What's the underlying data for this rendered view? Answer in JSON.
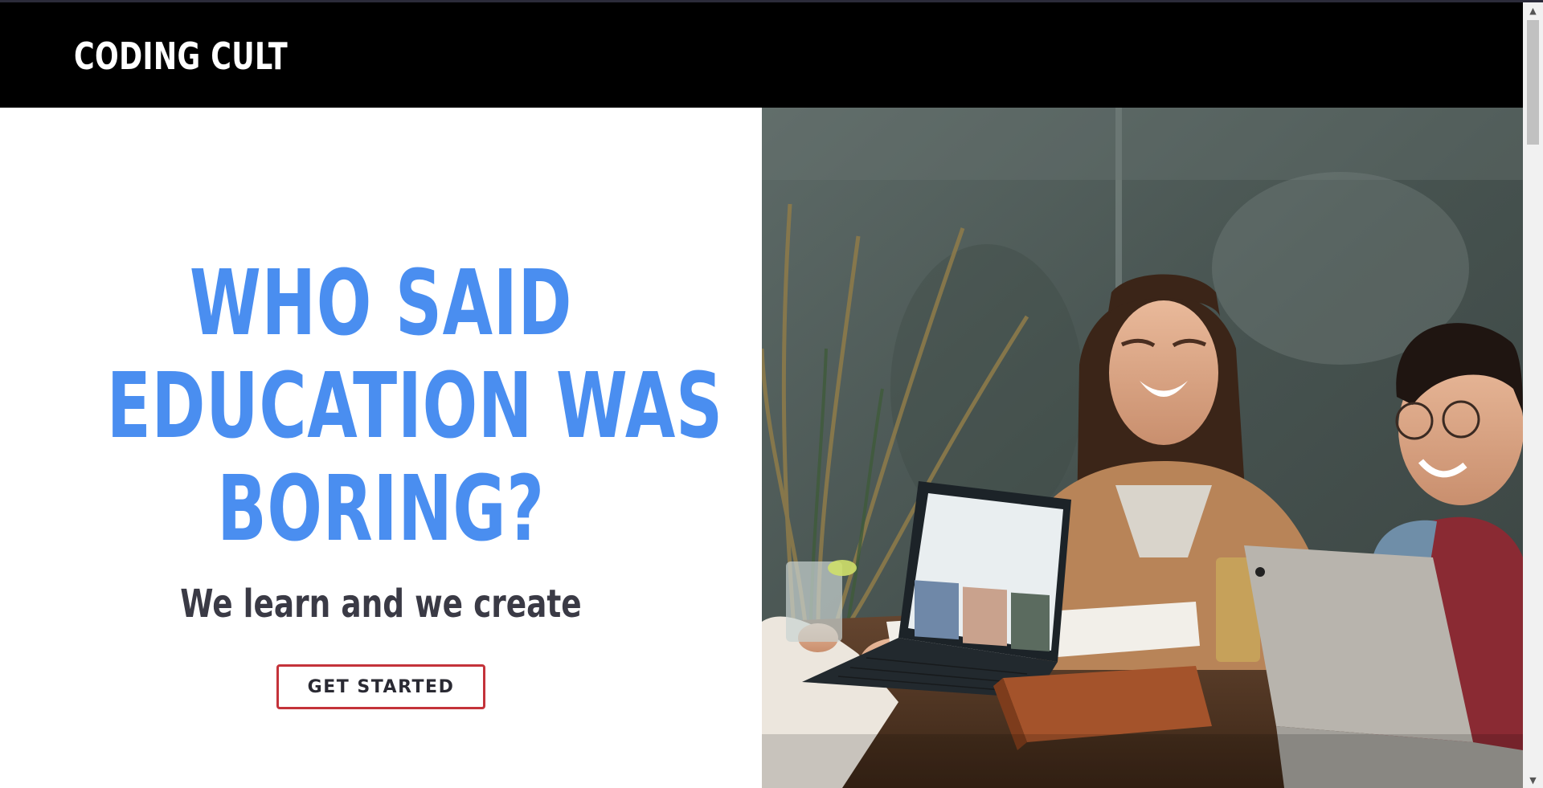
{
  "header": {
    "brand": "CODING CULT"
  },
  "hero": {
    "headline_lines": [
      "WHO SAID",
      "EDUCATION WAS",
      "BORING?"
    ],
    "subheading": "We learn and we create",
    "cta_label": "GET STARTED"
  },
  "photo": {
    "description_icon": "hero-photo-students-laughing-with-laptops"
  },
  "colors": {
    "navbar_bg": "#000000",
    "brand_text": "#ffffff",
    "headline": "#4a8ef0",
    "subheading": "#3a3a45",
    "cta_border": "#c4333a"
  },
  "scrollbar": {
    "up_icon": "scroll-up-arrow-icon",
    "down_icon": "scroll-down-arrow-icon"
  }
}
